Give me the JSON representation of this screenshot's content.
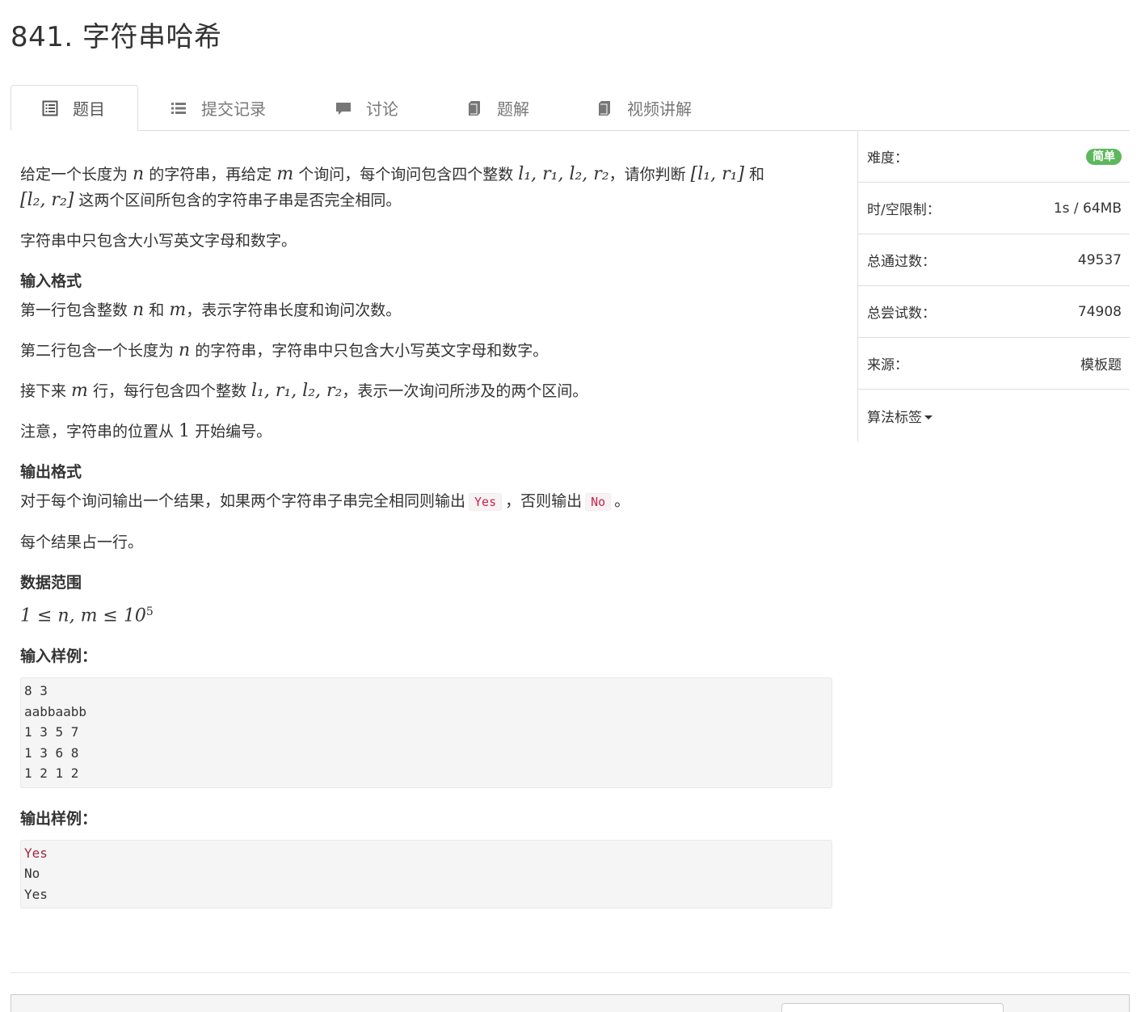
{
  "problem": {
    "title": "841. 字符串哈希"
  },
  "tabs": [
    {
      "label": "题目",
      "icon": "list-alt-icon"
    },
    {
      "label": "提交记录",
      "icon": "list-icon"
    },
    {
      "label": "讨论",
      "icon": "comment-icon"
    },
    {
      "label": "题解",
      "icon": "book-icon"
    },
    {
      "label": "视频讲解",
      "icon": "book-icon"
    }
  ],
  "description": {
    "p1_a": "给定一个长度为 ",
    "p1_n": "n",
    "p1_b": " 的字符串，再给定 ",
    "p1_m": "m",
    "p1_c": " 个询问，每个询问包含四个整数 ",
    "p1_vars": "l₁, r₁, l₂, r₂",
    "p1_d": "，请你判断 ",
    "p1_range1": "[l₁, r₁]",
    "p1_e": " 和",
    "p1_range2": "[l₂, r₂]",
    "p1_f": " 这两个区间所包含的字符串子串是否完全相同。",
    "p2": "字符串中只包含大小写英文字母和数字。"
  },
  "input_format": {
    "title": "输入格式",
    "l1_a": "第一行包含整数 ",
    "l1_n": "n",
    "l1_b": " 和 ",
    "l1_m": "m",
    "l1_c": "，表示字符串长度和询问次数。",
    "l2_a": "第二行包含一个长度为 ",
    "l2_n": "n",
    "l2_b": " 的字符串，字符串中只包含大小写英文字母和数字。",
    "l3_a": "接下来 ",
    "l3_m": "m",
    "l3_b": " 行，每行包含四个整数 ",
    "l3_vars": "l₁, r₁, l₂, r₂",
    "l3_c": "，表示一次询问所涉及的两个区间。",
    "l4_a": "注意，字符串的位置从 ",
    "l4_one": "1",
    "l4_b": " 开始编号。"
  },
  "output_format": {
    "title": "输出格式",
    "l1_a": "对于每个询问输出一个结果，如果两个字符串子串完全相同则输出",
    "yes": "Yes",
    "l1_b": "，否则输出",
    "no": "No",
    "l1_c": "。",
    "l2": "每个结果占一行。"
  },
  "data_range": {
    "title": "数据范围",
    "formula": "1 ≤ n, m ≤ 10",
    "exp": "5"
  },
  "sample_input": {
    "title": "输入样例：",
    "text": "8 3\naabbaabb\n1 3 5 7\n1 3 6 8\n1 2 1 2"
  },
  "sample_output": {
    "title": "输出样例：",
    "first_line": "Yes",
    "rest": "No\nYes"
  },
  "sidebar": {
    "difficulty_label": "难度：",
    "difficulty_value": "简单",
    "difficulty_color": "#5cb85c",
    "limit_label": "时/空限制：",
    "limit_value": "1s / 64MB",
    "passed_label": "总通过数：",
    "passed_value": "49537",
    "attempts_label": "总尝试数：",
    "attempts_value": "74908",
    "source_label": "来源：",
    "source_value": "模板题",
    "tags_label": "算法标签"
  }
}
